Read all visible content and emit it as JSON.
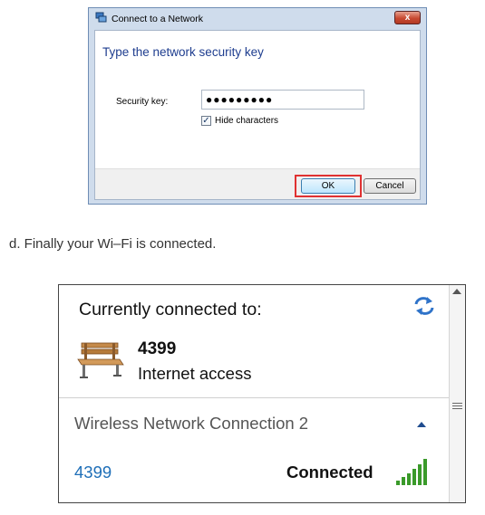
{
  "dialog": {
    "title": "Connect to a Network",
    "close_symbol": "x",
    "heading": "Type the network security key",
    "security_key_label": "Security key:",
    "security_key_value": "●●●●●●●●●",
    "hide_characters_label": "Hide characters",
    "hide_characters_checked": true,
    "ok_label": "OK",
    "cancel_label": "Cancel",
    "highlight_color": "#e03131"
  },
  "caption": "d. Finally your Wi–Fi is connected.",
  "network_panel": {
    "currently_connected_label": "Currently connected to:",
    "network_name": "4399",
    "network_access": "Internet access",
    "connection_group": "Wireless Network Connection 2",
    "network_link": "4399",
    "status": "Connected",
    "icons": {
      "refresh": "refresh-icon",
      "network": "bench-icon",
      "signal": "signal-strength-icon"
    },
    "colors": {
      "link": "#1f6fb8",
      "signal": "#3a9a2a"
    }
  }
}
